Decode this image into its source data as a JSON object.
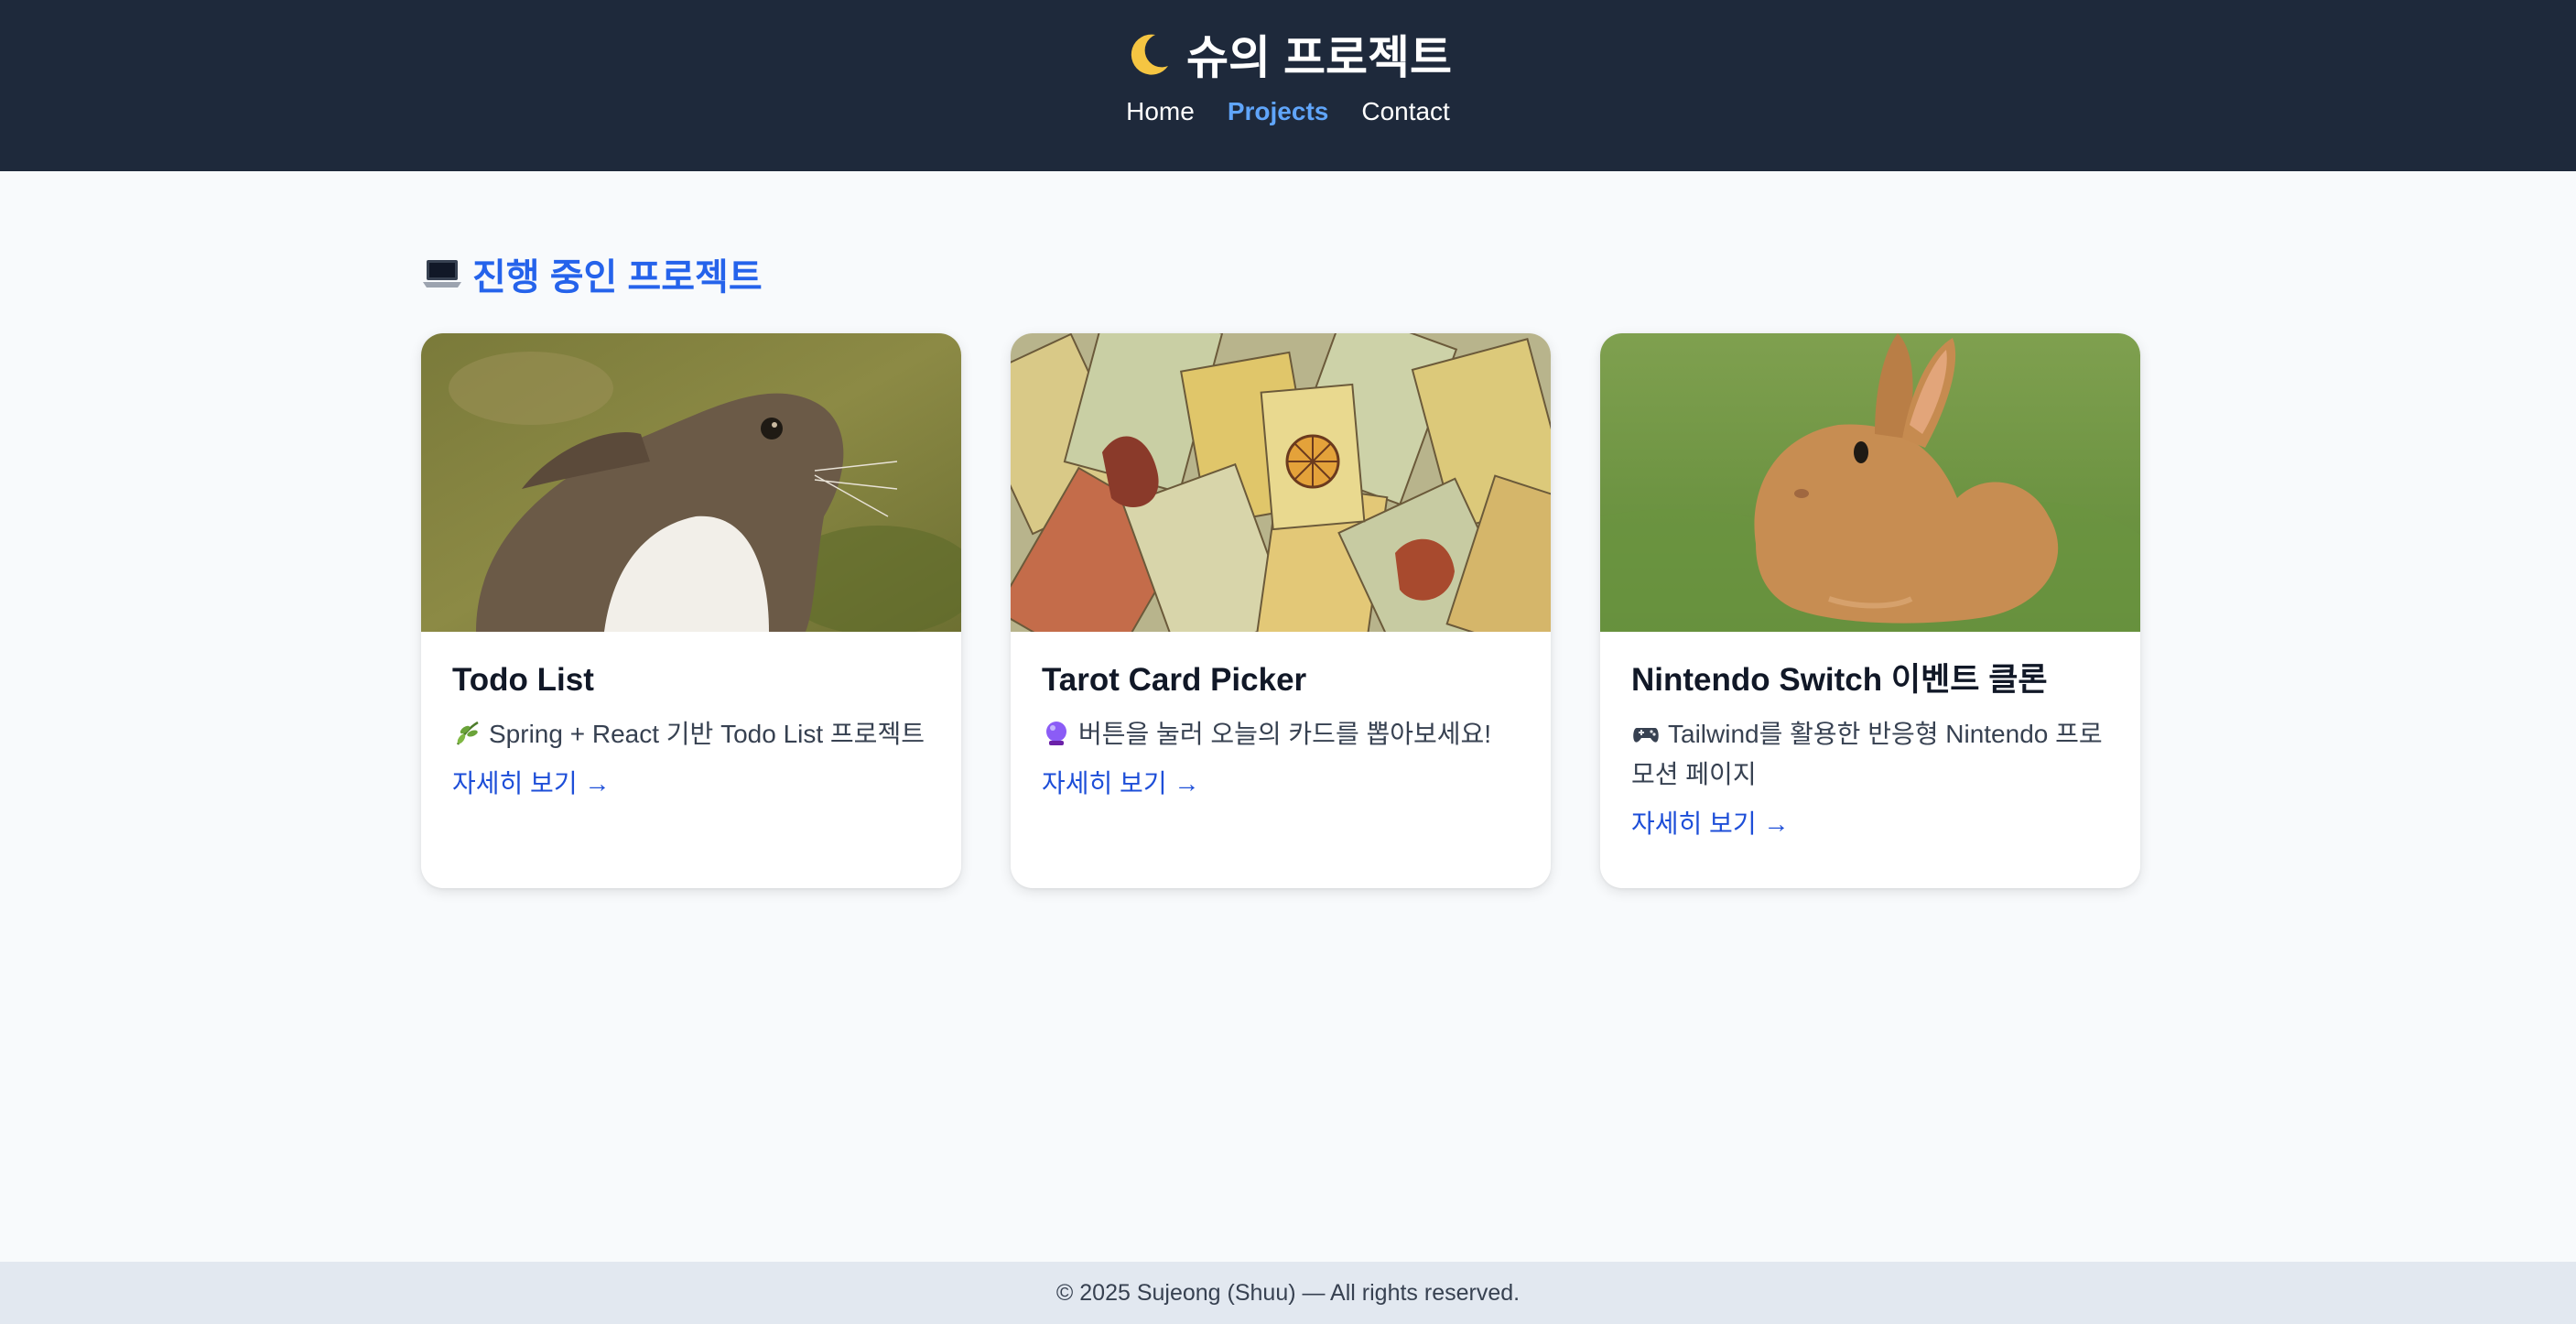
{
  "header": {
    "title": "슈의 프로젝트",
    "title_icon": "moon-icon",
    "nav": [
      {
        "label": "Home",
        "active": false
      },
      {
        "label": "Projects",
        "active": true
      },
      {
        "label": "Contact",
        "active": false
      }
    ]
  },
  "section": {
    "icon": "laptop-icon",
    "title": "진행 중인 프로젝트"
  },
  "cards": [
    {
      "image": "rabbit-photo",
      "title": "Todo List",
      "icon": "herb-icon",
      "description": "Spring + React 기반 Todo List 프로젝트",
      "link": "자세히 보기 →"
    },
    {
      "image": "tarot-cards-photo",
      "title": "Tarot Card Picker",
      "icon": "crystal-ball-icon",
      "description": "버튼을 눌러 오늘의 카드를 뽑아보세요!",
      "link": "자세히 보기 →"
    },
    {
      "image": "brown-rabbit-photo",
      "title": "Nintendo Switch 이벤트 클론",
      "icon": "game-controller-icon",
      "description": "Tailwind를 활용한 반응형 Nintendo 프로모션 페이지",
      "link": "자세히 보기 →"
    }
  ],
  "footer": {
    "text": "© 2025 Sujeong (Shuu) — All rights reserved."
  },
  "colors": {
    "header_bg": "#1e293b",
    "accent": "#2563eb",
    "nav_active": "#60a5fa",
    "footer_bg": "#e2e8f0",
    "page_bg": "#f8fafc"
  }
}
